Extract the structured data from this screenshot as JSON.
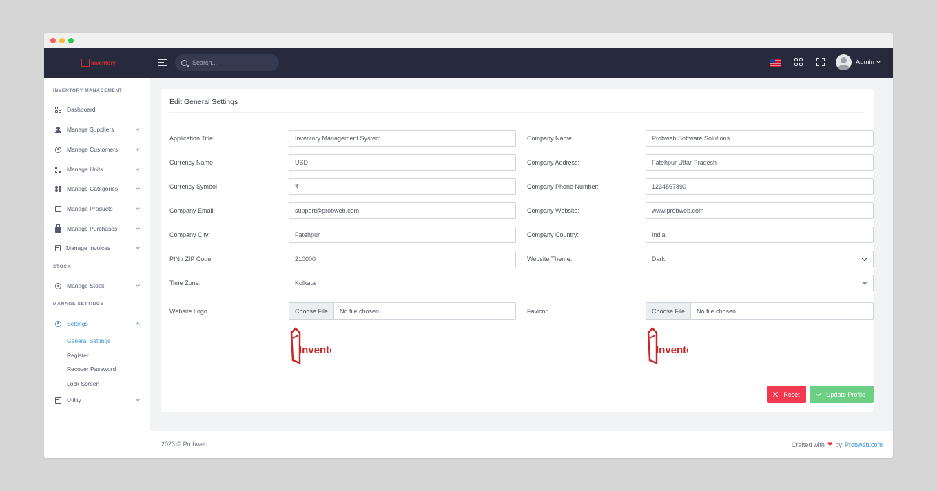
{
  "brand": {
    "name": "Inventory",
    "color": "#d32f2f"
  },
  "topbar": {
    "search_placeholder": "Search...",
    "user_name": "Admin",
    "icons": [
      "hamburger-icon",
      "search-icon",
      "us-flag-icon",
      "apps-grid-icon",
      "fullscreen-icon",
      "avatar"
    ]
  },
  "sidebar": {
    "sections": [
      "INVENTORY MANAGEMENT",
      "STOCK",
      "MANAGE SETTINGS"
    ],
    "items": [
      {
        "label": "Dashboard",
        "icon": "dashboard-icon"
      },
      {
        "label": "Manage Suppliers",
        "icon": "user-icon"
      },
      {
        "label": "Manage Customers",
        "icon": "customer-icon"
      },
      {
        "label": "Manage Units",
        "icon": "units-icon"
      },
      {
        "label": "Manage Categories",
        "icon": "categories-icon"
      },
      {
        "label": "Manage Products",
        "icon": "box-icon"
      },
      {
        "label": "Manage Purchases",
        "icon": "bag-icon"
      },
      {
        "label": "Manage Invoices",
        "icon": "invoice-icon"
      },
      {
        "label": "Manage Stock",
        "icon": "stock-icon"
      },
      {
        "label": "Settings",
        "icon": "settings-icon"
      },
      {
        "label": "Utility",
        "icon": "utility-icon"
      }
    ],
    "settings_sub": [
      "General Settings",
      "Register",
      "Recover Password",
      "Lock Screen"
    ]
  },
  "form": {
    "title": "Edit General Settings",
    "app_title": {
      "label": "Application Title:",
      "value": "Inventory Management System"
    },
    "company_name": {
      "label": "Company Name:",
      "value": "Probweb Software Solutions"
    },
    "currency_name": {
      "label": "Currency Name",
      "value": "USD"
    },
    "company_address": {
      "label": "Company Address:",
      "value": "Fatehpur Uttar Pradesh"
    },
    "currency_symbol": {
      "label": "Currency Symbol",
      "value": "₹"
    },
    "company_phone": {
      "label": "Company Phone Number:",
      "value": "1234567890"
    },
    "company_email": {
      "label": "Company Email:",
      "value": "support@probweb.com"
    },
    "company_website": {
      "label": "Company Website:",
      "value": "www.probweb.com"
    },
    "company_city": {
      "label": "Company City:",
      "value": "Fatehpur"
    },
    "company_country": {
      "label": "Company Country:",
      "value": "India"
    },
    "pin_code": {
      "label": "PIN / ZIP Code:",
      "value": "210000"
    },
    "website_theme": {
      "label": "Website Theme:",
      "value": "Dark"
    },
    "time_zone": {
      "label": "Time Zone:",
      "value": "Kolkata"
    },
    "website_logo": {
      "label": "Website Logo",
      "button": "Choose File",
      "status": "No file chosen"
    },
    "favicon": {
      "label": "Favicon",
      "button": "Choose File",
      "status": "No file chosen"
    },
    "reset_label": "Reset",
    "update_label": "Update Profile"
  },
  "footer": {
    "copyright": "2023 © Probweb.",
    "crafted_prefix": "Crafted with",
    "heart": "❤",
    "by": "by",
    "link": "Probweb.com"
  },
  "colors": {
    "topbar": "#262a3c",
    "accent": "#3b93d8",
    "reset": "#f1394f",
    "update": "#6ccf84"
  }
}
